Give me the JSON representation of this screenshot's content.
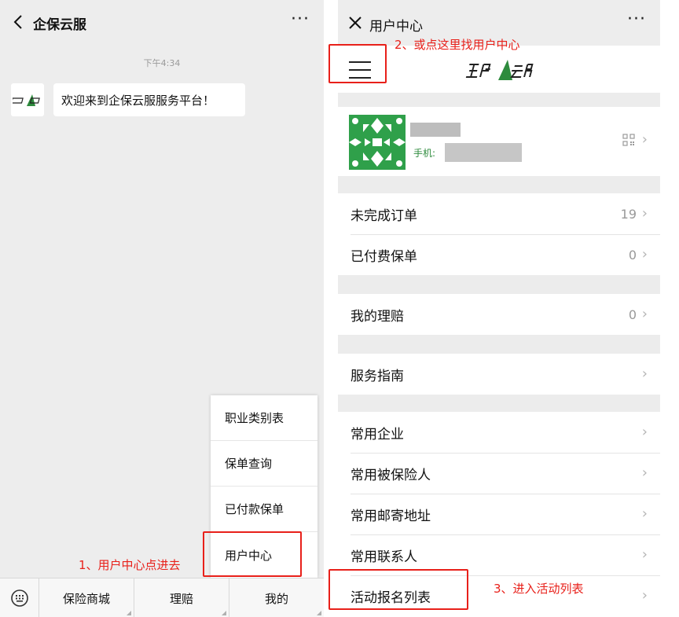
{
  "left": {
    "header": {
      "title": "企保云服",
      "more": "···"
    },
    "chat": {
      "time": "下午4:34",
      "message": "欢迎来到企保云服服务平台！"
    },
    "popup_menu": [
      "职业类别表",
      "保单查询",
      "已付款保单",
      "用户中心"
    ],
    "tabbar": [
      "保险商城",
      "理赔",
      "我的"
    ]
  },
  "right": {
    "header": {
      "title": "用户中心",
      "more": "···"
    },
    "profile": {
      "phone_label": "手机:"
    },
    "groups": [
      [
        {
          "label": "未完成订单",
          "count": "19"
        },
        {
          "label": "已付费保单",
          "count": "0"
        }
      ],
      [
        {
          "label": "我的理赔",
          "count": "0"
        }
      ],
      [
        {
          "label": "服务指南",
          "count": ""
        }
      ],
      [
        {
          "label": "常用企业",
          "count": ""
        },
        {
          "label": "常用被保险人",
          "count": ""
        },
        {
          "label": "常用邮寄地址",
          "count": ""
        },
        {
          "label": "常用联系人",
          "count": ""
        },
        {
          "label": "活动报名列表",
          "count": ""
        }
      ]
    ]
  },
  "annotations": {
    "step1": "1、用户中心点进去",
    "step2": "2、或点这里找用户中心",
    "step3": "3、进入活动列表"
  },
  "colors": {
    "brand_green": "#2e8b3d",
    "annotation_red": "#e8201a"
  }
}
